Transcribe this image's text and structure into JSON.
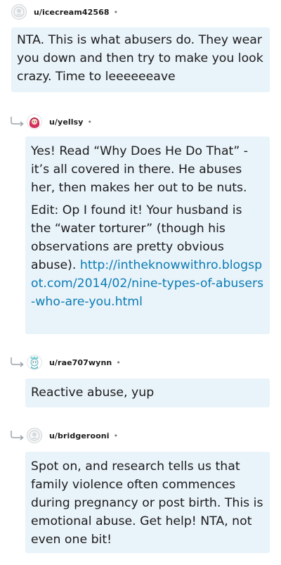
{
  "comments": [
    {
      "username": "u/icecream42568",
      "separator": "•",
      "avatar_icon": "default-avatar-icon",
      "body": [
        "NTA. This is what abusers do. They wear you down and then try to make you look crazy. Time to leeeeeeave"
      ]
    },
    {
      "username": "u/yellsy",
      "separator": "•",
      "avatar_icon": "red-character-avatar-icon",
      "body": [
        "Yes! Read “Why Does He Do That” - it’s all covered in there. He abuses her, then makes her out to be nuts.",
        "Edit: Op I found it! Your husband is the “water torturer” (though his observations are pretty obvious abuse)."
      ],
      "link": "http://intheknowwithro.blogspot.com/2014/02/nine-types-of-abusers-who-are-you.html"
    },
    {
      "username": "u/rae707wynn",
      "separator": "•",
      "avatar_icon": "teal-character-avatar-icon",
      "body": [
        "Reactive abuse, yup"
      ]
    },
    {
      "username": "u/bridgerooni",
      "separator": "•",
      "avatar_icon": "default-avatar-icon",
      "body": [
        "Spot on, and research tells us that family violence often commences during pregnancy or post birth. This is emotional abuse. Get help! NTA, not even one bit!"
      ]
    }
  ],
  "colors": {
    "bubble_bg": "#e9f3fa",
    "text": "#1c1c1c",
    "link": "#0b7cb4",
    "meta": "#7c7c7c"
  }
}
